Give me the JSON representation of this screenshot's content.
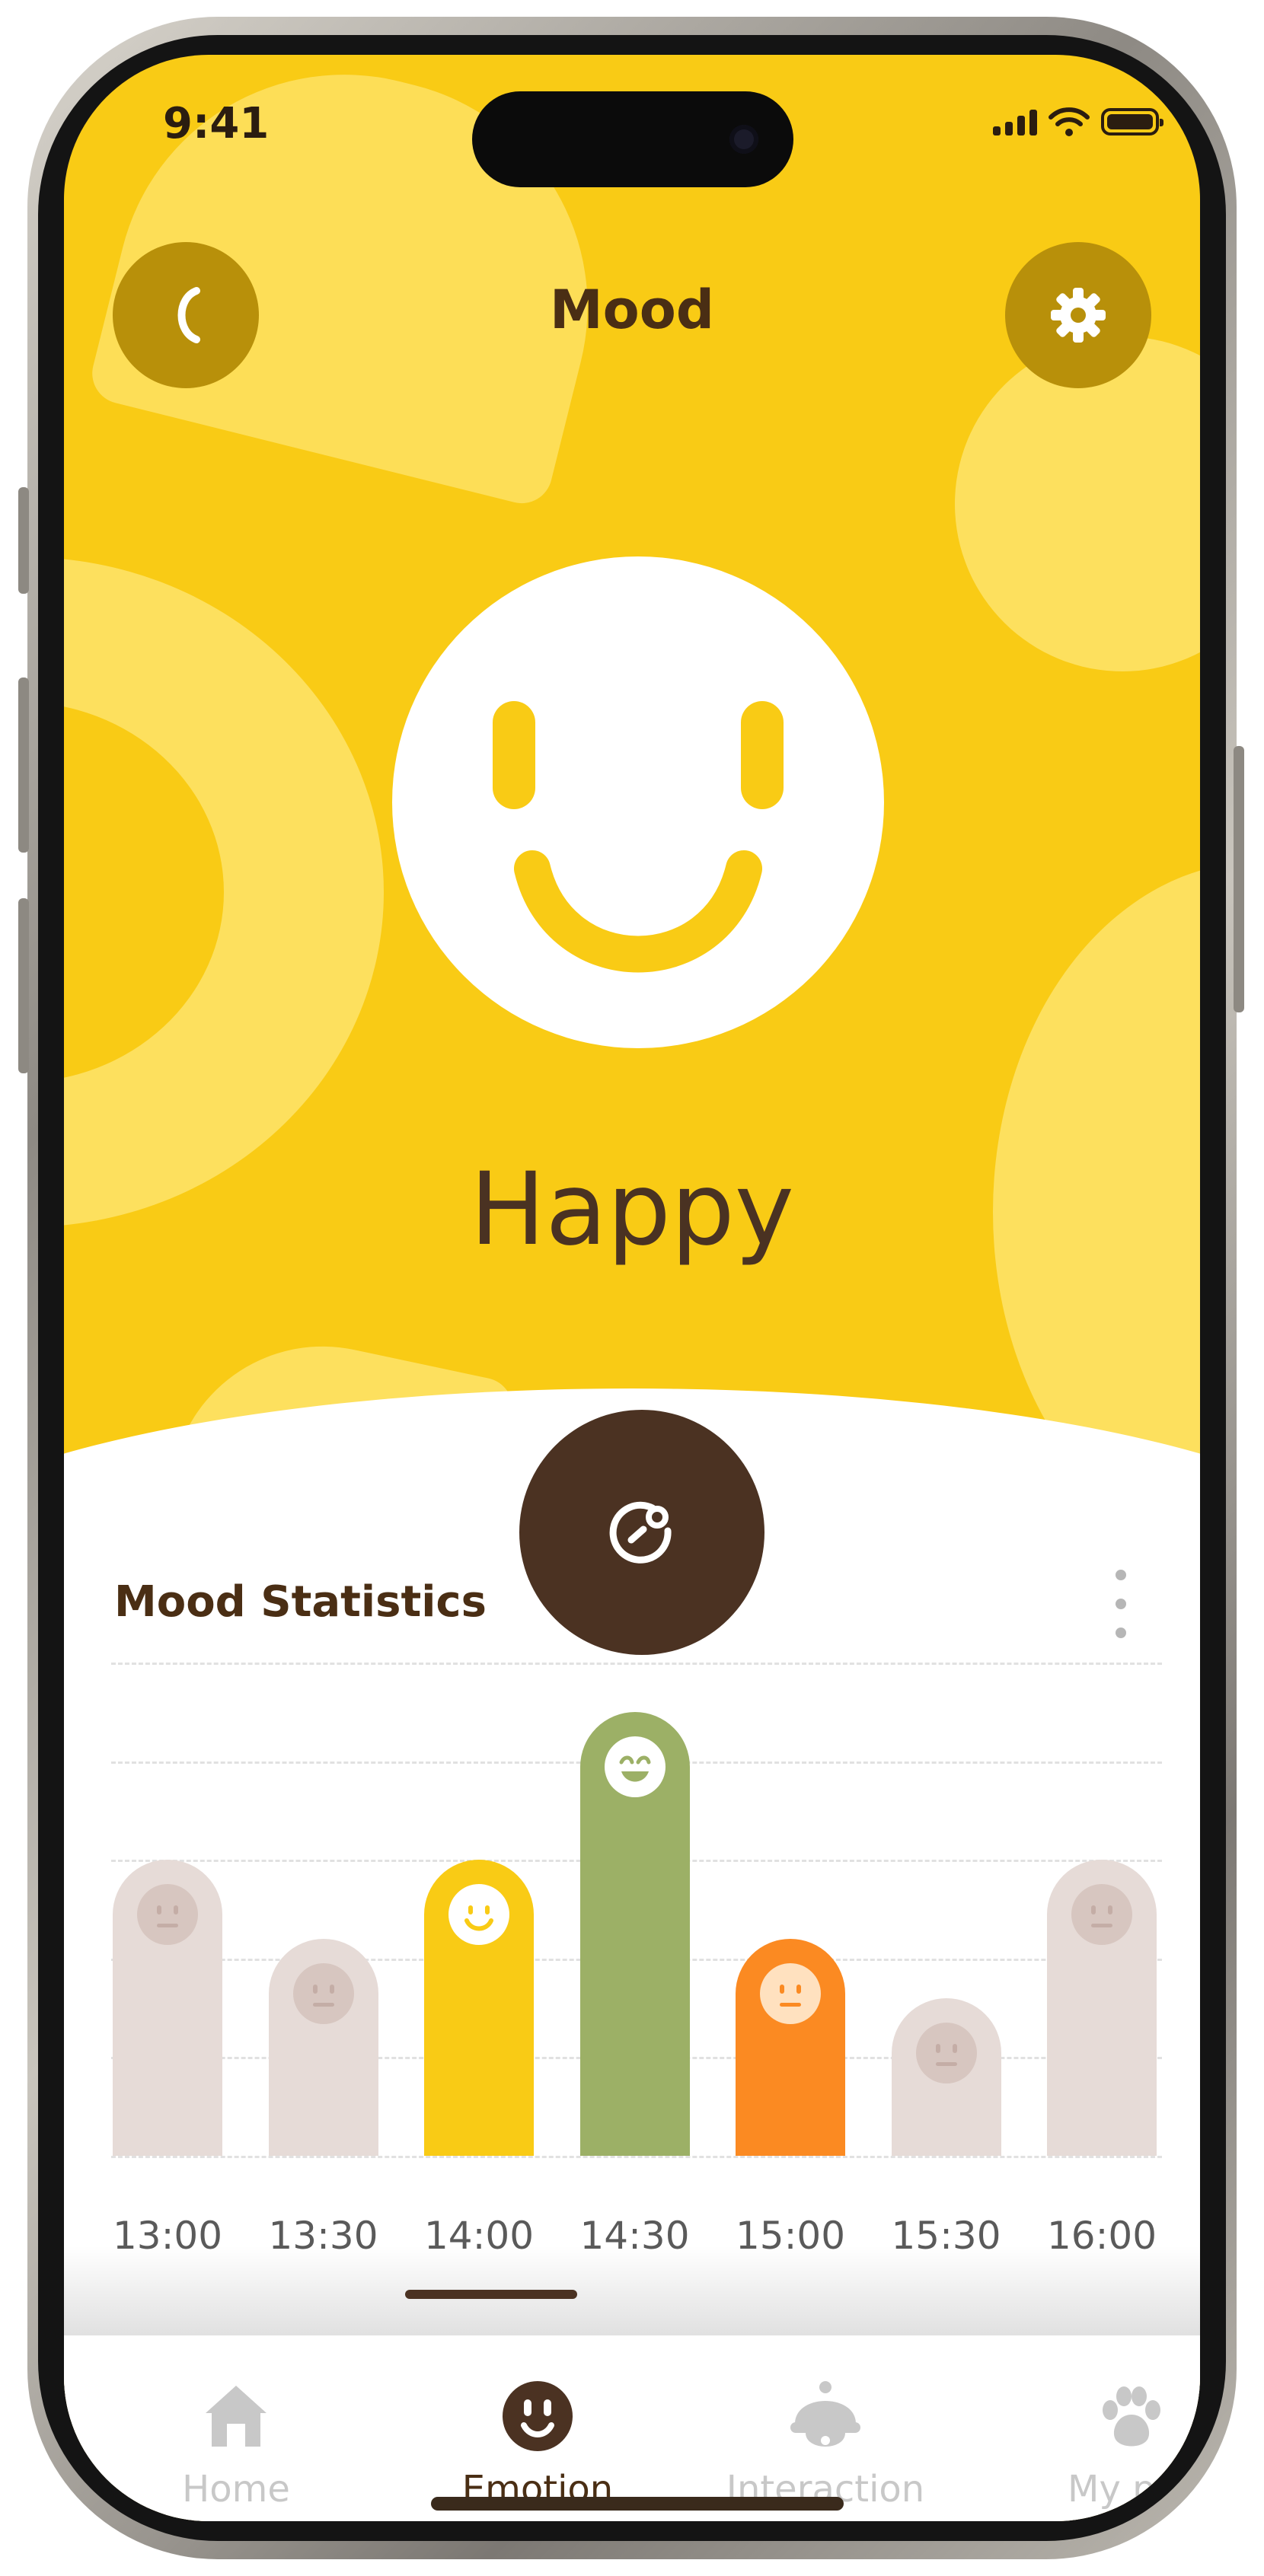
{
  "status_bar": {
    "time": "9:41"
  },
  "header": {
    "title": "Mood"
  },
  "mood": {
    "label": "Happy"
  },
  "stats": {
    "title": "Mood Statistics"
  },
  "colors": {
    "brand_yellow": "#f9cb15",
    "brown": "#4b3222",
    "neutral_bar": "#e6dbd7",
    "happy_bar": "#f9cb15",
    "very_happy_bar": "#9cb066",
    "meh_bar": "#fb8a22"
  },
  "chart_data": {
    "type": "bar",
    "categories": [
      "13:00",
      "13:30",
      "14:00",
      "14:30",
      "15:00",
      "15:30",
      "16:00"
    ],
    "values": [
      3,
      2.2,
      3,
      4.5,
      2.2,
      1.6,
      3
    ],
    "moods": [
      "neutral",
      "neutral",
      "happy",
      "very-happy",
      "meh",
      "neutral",
      "neutral"
    ],
    "ylim": [
      0,
      5
    ],
    "grid": true
  },
  "tabs": [
    {
      "label": "Home",
      "icon": "house-icon",
      "active": false
    },
    {
      "label": "Emotion",
      "icon": "smiley-icon",
      "active": true
    },
    {
      "label": "Interaction",
      "icon": "bell-icon",
      "active": false
    },
    {
      "label": "My pet",
      "icon": "paw-icon",
      "active": false
    }
  ]
}
